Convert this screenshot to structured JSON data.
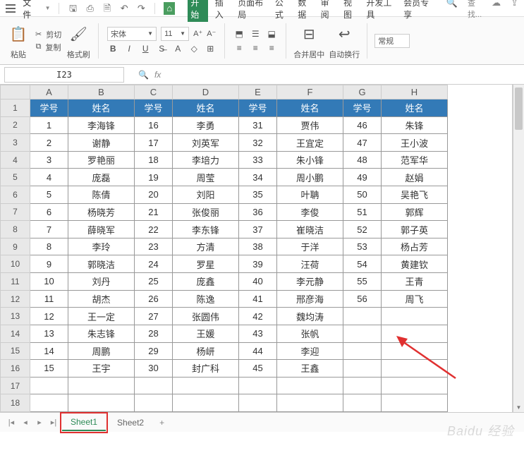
{
  "topbar": {
    "file": "文件",
    "search": "查找..."
  },
  "menu": {
    "start": "开始",
    "insert": "插入",
    "layout": "页面布局",
    "formula": "公式",
    "data": "数据",
    "review": "审阅",
    "view": "视图",
    "dev": "开发工具",
    "vip": "会员专享"
  },
  "ribbon": {
    "paste": "粘贴",
    "cut": "剪切",
    "copy": "复制",
    "format_painter": "格式刷",
    "font_name": "宋体",
    "font_size": "11",
    "merge": "合并居中",
    "wrap": "自动换行",
    "numfmt": "常规"
  },
  "namebox": "I23",
  "cols": [
    "A",
    "B",
    "C",
    "D",
    "E",
    "F",
    "G",
    "H"
  ],
  "dataHeader": [
    "学号",
    "姓名",
    "学号",
    "姓名",
    "学号",
    "姓名",
    "学号",
    "姓名"
  ],
  "rows": [
    [
      "1",
      "李海锋",
      "16",
      "李勇",
      "31",
      "贾伟",
      "46",
      "朱锋"
    ],
    [
      "2",
      "谢静",
      "17",
      "刘英军",
      "32",
      "王宜定",
      "47",
      "王小波"
    ],
    [
      "3",
      "罗艳丽",
      "18",
      "李培力",
      "33",
      "朱小锋",
      "48",
      "范军华"
    ],
    [
      "4",
      "庞磊",
      "19",
      "周莹",
      "34",
      "周小鹏",
      "49",
      "赵娟"
    ],
    [
      "5",
      "陈倩",
      "20",
      "刘阳",
      "35",
      "叶聃",
      "50",
      "吴艳飞"
    ],
    [
      "6",
      "杨晓芳",
      "21",
      "张俊丽",
      "36",
      "李俊",
      "51",
      "郭辉"
    ],
    [
      "7",
      "薛晓军",
      "22",
      "李东锋",
      "37",
      "崔晓洁",
      "52",
      "郭子英"
    ],
    [
      "8",
      "李玲",
      "23",
      "方清",
      "38",
      "于洋",
      "53",
      "杨占芳"
    ],
    [
      "9",
      "郭晓洁",
      "24",
      "罗星",
      "39",
      "汪荷",
      "54",
      "黄建钦"
    ],
    [
      "10",
      "刘丹",
      "25",
      "庞鑫",
      "40",
      "李元静",
      "55",
      "王青"
    ],
    [
      "11",
      "胡杰",
      "26",
      "陈逸",
      "41",
      "邢彦海",
      "56",
      "周飞"
    ],
    [
      "12",
      "王一定",
      "27",
      "张圆伟",
      "42",
      "魏均涛",
      "",
      ""
    ],
    [
      "13",
      "朱志锋",
      "28",
      "王媛",
      "43",
      "张帆",
      "",
      ""
    ],
    [
      "14",
      "周鹏",
      "29",
      "杨岍",
      "44",
      "李迎",
      "",
      ""
    ],
    [
      "15",
      "王宇",
      "30",
      "封广科",
      "45",
      "王鑫",
      "",
      ""
    ]
  ],
  "emptyRows": [
    "17",
    "18"
  ],
  "sheets": {
    "s1": "Sheet1",
    "s2": "Sheet2"
  },
  "watermark": "Baidu 经验"
}
